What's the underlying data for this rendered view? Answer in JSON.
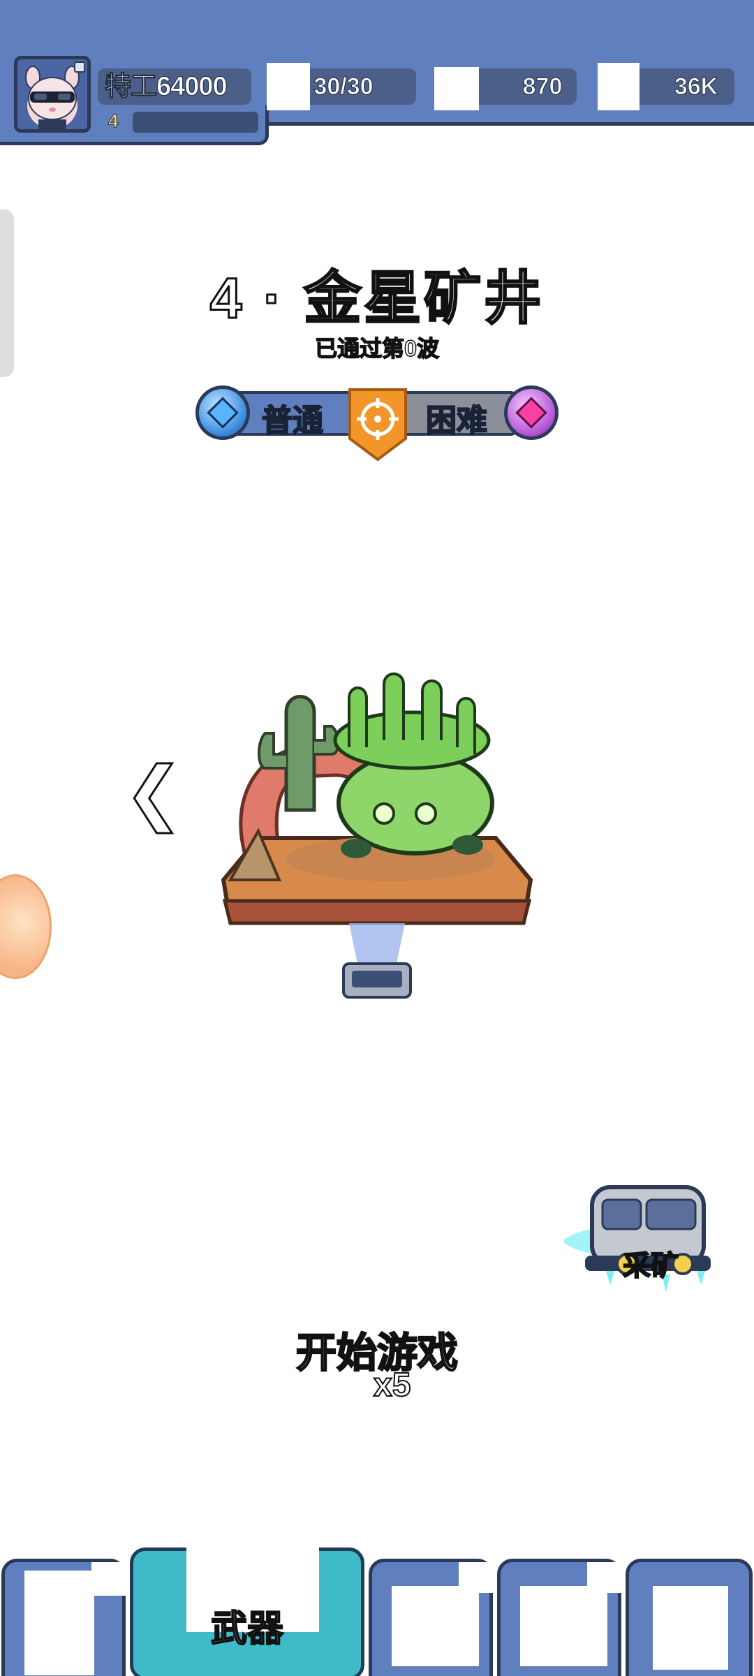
{
  "player": {
    "name": "特工64000",
    "level": "4"
  },
  "resources": {
    "stamina": "30/30",
    "gems": "870",
    "coins": "36K"
  },
  "level": {
    "title": "4 · 金星矿井",
    "wave_status": "已通过第0波"
  },
  "difficulty": {
    "normal_label": "普通",
    "hard_label": "困难",
    "selected": "普通"
  },
  "navigation": {
    "prev_glyph": "❮"
  },
  "mining": {
    "label": "采矿"
  },
  "start": {
    "label": "开始游戏",
    "cost": "x5"
  },
  "bottom_nav": {
    "active_label": "武器"
  },
  "colors": {
    "bar_blue": "#5f7fbf",
    "dark_outline": "#2c3a5a",
    "active_tab": "#3fbac8"
  }
}
